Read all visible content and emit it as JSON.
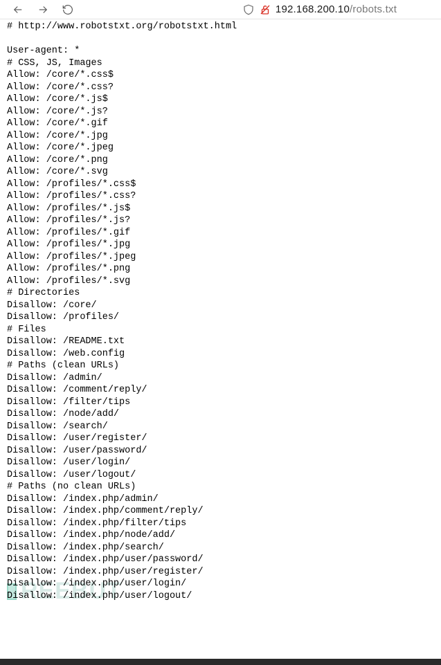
{
  "url": {
    "host": "192.168.200.10",
    "path": "/robots.txt"
  },
  "robots_lines": [
    "# http://www.robotstxt.org/robotstxt.html",
    "",
    "User-agent: *",
    "# CSS, JS, Images",
    "Allow: /core/*.css$",
    "Allow: /core/*.css?",
    "Allow: /core/*.js$",
    "Allow: /core/*.js?",
    "Allow: /core/*.gif",
    "Allow: /core/*.jpg",
    "Allow: /core/*.jpeg",
    "Allow: /core/*.png",
    "Allow: /core/*.svg",
    "Allow: /profiles/*.css$",
    "Allow: /profiles/*.css?",
    "Allow: /profiles/*.js$",
    "Allow: /profiles/*.js?",
    "Allow: /profiles/*.gif",
    "Allow: /profiles/*.jpg",
    "Allow: /profiles/*.jpeg",
    "Allow: /profiles/*.png",
    "Allow: /profiles/*.svg",
    "# Directories",
    "Disallow: /core/",
    "Disallow: /profiles/",
    "# Files",
    "Disallow: /README.txt",
    "Disallow: /web.config",
    "# Paths (clean URLs)",
    "Disallow: /admin/",
    "Disallow: /comment/reply/",
    "Disallow: /filter/tips",
    "Disallow: /node/add/",
    "Disallow: /search/",
    "Disallow: /user/register/",
    "Disallow: /user/password/",
    "Disallow: /user/login/",
    "Disallow: /user/logout/",
    "# Paths (no clean URLs)",
    "Disallow: /index.php/admin/",
    "Disallow: /index.php/comment/reply/",
    "Disallow: /index.php/filter/tips",
    "Disallow: /index.php/node/add/",
    "Disallow: /index.php/search/",
    "Disallow: /index.php/user/password/",
    "Disallow: /index.php/user/register/",
    "Disallow: /index.php/user/login/",
    "Disallow: /index.php/user/logout/"
  ],
  "watermark": "REEBUT"
}
